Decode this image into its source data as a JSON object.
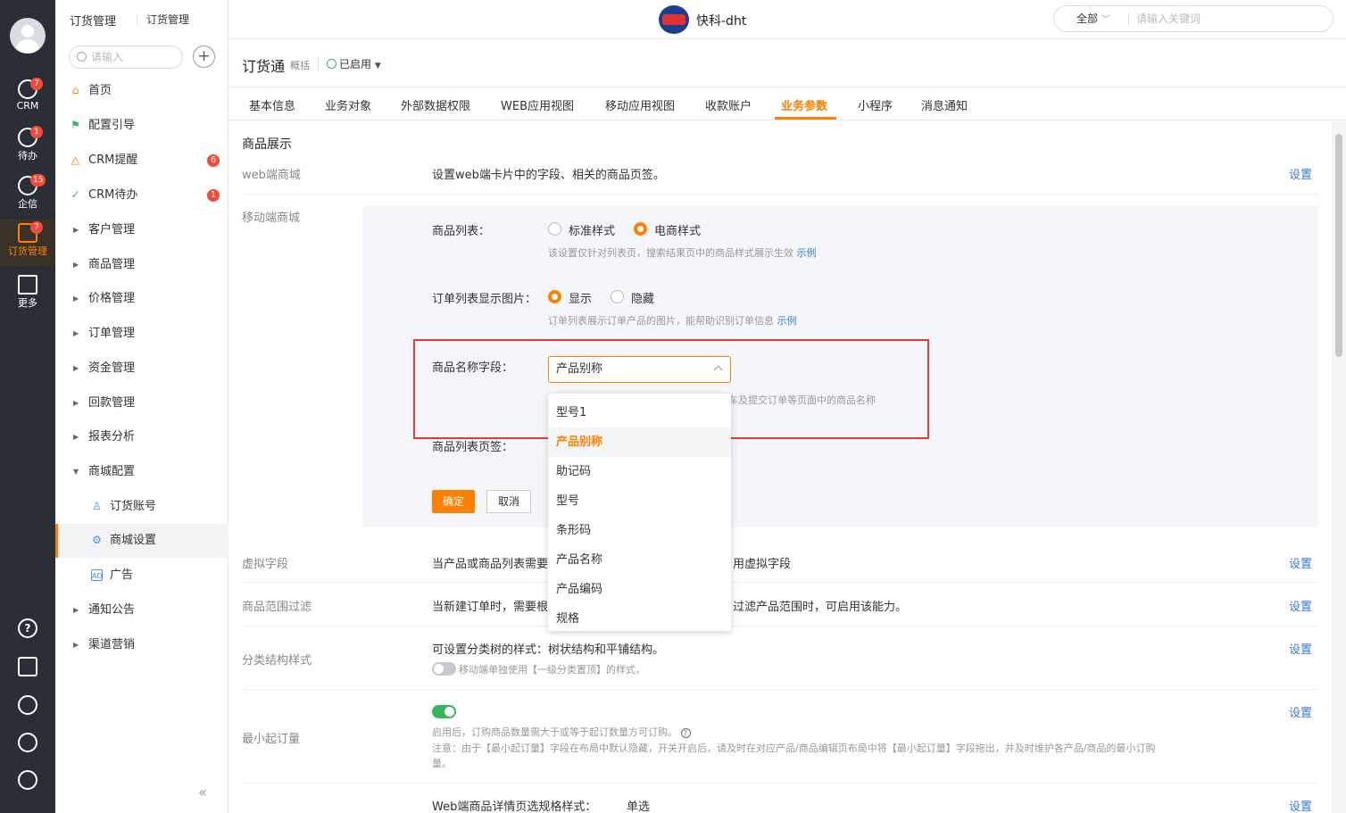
{
  "rail": {
    "items": [
      {
        "label": "CRM",
        "badge": "7"
      },
      {
        "label": "待办",
        "badge": "1"
      },
      {
        "label": "企信",
        "badge": "15"
      },
      {
        "label": "订货管理",
        "badge": "7"
      },
      {
        "label": "更多",
        "badge": ""
      }
    ],
    "bottom_icons": [
      "help-icon",
      "notebook-icon",
      "clock-icon",
      "contacts-icon",
      "settings-icon"
    ]
  },
  "breadcrumb": {
    "first": "订货管理",
    "second": "订货管理"
  },
  "nav": {
    "search_placeholder": "请输入",
    "items": [
      {
        "label": "首页"
      },
      {
        "label": "配置引导"
      },
      {
        "label": "CRM提醒",
        "badge": "6"
      },
      {
        "label": "CRM待办",
        "badge": "1"
      },
      {
        "label": "客户管理"
      },
      {
        "label": "商品管理"
      },
      {
        "label": "价格管理"
      },
      {
        "label": "订单管理"
      },
      {
        "label": "资金管理"
      },
      {
        "label": "回款管理"
      },
      {
        "label": "报表分析"
      },
      {
        "label": "商城配置"
      },
      {
        "label": "订货账号"
      },
      {
        "label": "商城设置"
      },
      {
        "label": "广告"
      },
      {
        "label": "通知公告"
      },
      {
        "label": "渠道营销"
      }
    ]
  },
  "topbar": {
    "brand": "快科-dht",
    "search_scope": "全部",
    "search_placeholder": "请输入关键词"
  },
  "app": {
    "title": "订货通",
    "subtitle": "概括",
    "status": "已启用"
  },
  "tabs": [
    "基本信息",
    "业务对象",
    "外部数据权限",
    "WEB应用视图",
    "移动应用视图",
    "收款账户",
    "业务参数",
    "小程序",
    "消息通知"
  ],
  "content": {
    "section_title": "商品展示",
    "web_mall": {
      "label": "web端商城",
      "desc": "设置web端卡片中的字段、相关的商品页签。",
      "action": "设置"
    },
    "mobile_mall": {
      "label": "移动端商城",
      "product_list": {
        "label": "商品列表：",
        "opt1": "标准样式",
        "opt2": "电商样式",
        "hint": "该设置仅针对列表页，搜索结果页中的商品样式展示生效",
        "example": "示例"
      },
      "order_image": {
        "label": "订单列表显示图片：",
        "opt1": "显示",
        "opt2": "隐藏",
        "hint": "订单列表展示订单产品的图片，能帮助识别订单信息",
        "example": "示例"
      },
      "name_field": {
        "label": "商品名称字段：",
        "value": "产品别称",
        "hint_tail": "车及提交订单等页面中的商品名称"
      },
      "list_tabs": {
        "label": "商品列表页签："
      },
      "ok": "确定",
      "cancel": "取消"
    },
    "virtual_field": {
      "label": "虚拟字段",
      "desc_a": "当产品或商品列表需要",
      "desc_b": "用虚拟字段",
      "action": "设置"
    },
    "range_filter": {
      "label": "商品范围过滤",
      "desc_a": "当新建订单时，需要根",
      "desc_b": "过滤产品范围时，可启用该能力。",
      "action": "设置"
    },
    "category_style": {
      "label": "分类结构样式",
      "desc": "可设置分类树的样式：树状结构和平铺结构。",
      "toggle_text": "移动端单独使用【一级分类置顶】的样式，",
      "action": "设置"
    },
    "min_order": {
      "label": "最小起订量",
      "hint1": "启用后，订购商品数量需大于或等于起订数量方可订购。",
      "hint2": "注意：由于【最小起订量】字段在布局中默认隐藏，开关开启后，请及时在对应产品/商品编辑页布局中将【最小起订量】字段拖出，并及时维护各产品/商品的最小订购",
      "hint3": "量。",
      "action": "设置"
    },
    "spec_style": {
      "label": "Web端商品详情页选规格样式：",
      "value": "单选",
      "action": "设置"
    }
  },
  "dropdown": {
    "options": [
      "型号1",
      "产品别称",
      "助记码",
      "型号",
      "条形码",
      "产品名称",
      "产品编码",
      "规格"
    ],
    "selected": "产品别称"
  },
  "colors": {
    "accent": "#ff8000",
    "rail": "#2a2f37",
    "link": "#3a7bd5",
    "highlight_box": "#e53a3a",
    "toggle_on": "#35b560"
  }
}
